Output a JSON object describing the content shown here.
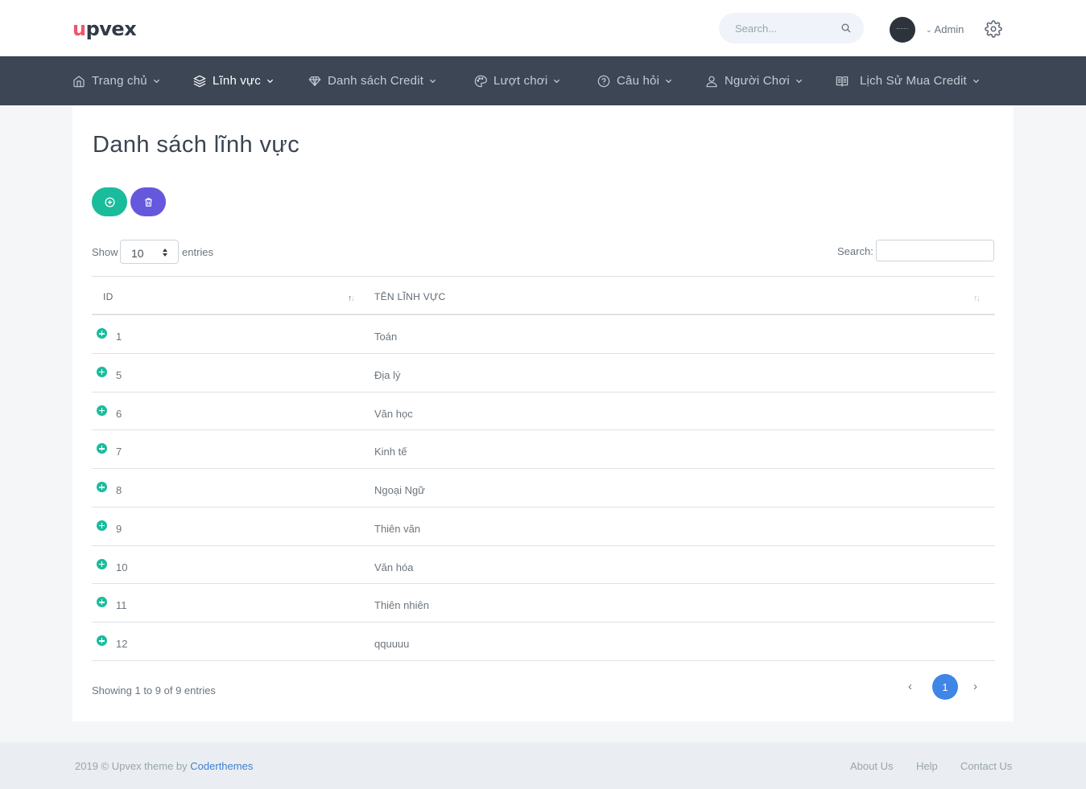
{
  "brand": {
    "logo_text": "upvex"
  },
  "topbar": {
    "search_placeholder": "Search...",
    "user_name": "Admin",
    "search_icon": "search-icon",
    "settings_icon": "gear-icon"
  },
  "nav": {
    "items": [
      {
        "label": "Trang chủ",
        "icon": "home-icon"
      },
      {
        "label": "Lĩnh vực",
        "icon": "layers-icon",
        "active": true
      },
      {
        "label": "Danh sách Credit",
        "icon": "diamond-icon"
      },
      {
        "label": "Lượt chơi",
        "icon": "palette-icon"
      },
      {
        "label": "Câu hỏi",
        "icon": "help-circle-icon"
      },
      {
        "label": "Người Chơi",
        "icon": "user-icon"
      },
      {
        "label": "Lịch Sử Mua Credit",
        "icon": "book-icon"
      }
    ]
  },
  "page": {
    "title": "Danh sách lĩnh vực",
    "add_button_icon": "plus-circle-icon",
    "delete_button_icon": "trash-icon"
  },
  "datatable": {
    "show_label": "Show",
    "entries_per_page": "10",
    "entries_label": "entries",
    "search_label": "Search:",
    "search_value": "",
    "columns": [
      "ID",
      "TÊN LĨNH VỰC"
    ],
    "rows": [
      {
        "id": "1",
        "name": "Toán"
      },
      {
        "id": "5",
        "name": "Địa lý"
      },
      {
        "id": "6",
        "name": "Văn học"
      },
      {
        "id": "7",
        "name": "Kinh tế"
      },
      {
        "id": "8",
        "name": "Ngoại Ngữ"
      },
      {
        "id": "9",
        "name": "Thiên văn"
      },
      {
        "id": "10",
        "name": "Văn hóa"
      },
      {
        "id": "11",
        "name": "Thiên nhiên"
      },
      {
        "id": "12",
        "name": "qquuuu"
      }
    ],
    "info": "Showing 1 to 9 of 9 entries",
    "pagination": {
      "prev": "‹",
      "current": "1",
      "next": "›"
    }
  },
  "footer": {
    "copyright": "2019 © Upvex theme by ",
    "author_link": "Coderthemes",
    "links": [
      "About Us",
      "Help",
      "Contact Us"
    ]
  },
  "colors": {
    "accent_green": "#1abc9c",
    "accent_purple": "#6658dd",
    "nav_bg": "#3c4655",
    "page_active_blue": "#3f86e6",
    "logo_orange": "#f1556c"
  }
}
